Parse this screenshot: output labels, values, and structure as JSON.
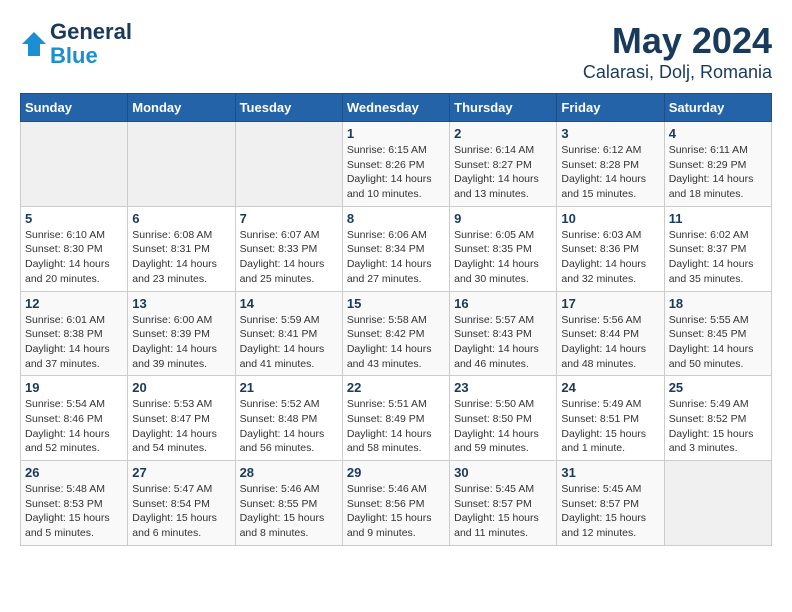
{
  "header": {
    "logo_line1": "General",
    "logo_line2": "Blue",
    "title": "May 2024",
    "subtitle": "Calarasi, Dolj, Romania"
  },
  "days_of_week": [
    "Sunday",
    "Monday",
    "Tuesday",
    "Wednesday",
    "Thursday",
    "Friday",
    "Saturday"
  ],
  "weeks": [
    [
      {
        "day": "",
        "info": ""
      },
      {
        "day": "",
        "info": ""
      },
      {
        "day": "",
        "info": ""
      },
      {
        "day": "1",
        "info": "Sunrise: 6:15 AM\nSunset: 8:26 PM\nDaylight: 14 hours\nand 10 minutes."
      },
      {
        "day": "2",
        "info": "Sunrise: 6:14 AM\nSunset: 8:27 PM\nDaylight: 14 hours\nand 13 minutes."
      },
      {
        "day": "3",
        "info": "Sunrise: 6:12 AM\nSunset: 8:28 PM\nDaylight: 14 hours\nand 15 minutes."
      },
      {
        "day": "4",
        "info": "Sunrise: 6:11 AM\nSunset: 8:29 PM\nDaylight: 14 hours\nand 18 minutes."
      }
    ],
    [
      {
        "day": "5",
        "info": "Sunrise: 6:10 AM\nSunset: 8:30 PM\nDaylight: 14 hours\nand 20 minutes."
      },
      {
        "day": "6",
        "info": "Sunrise: 6:08 AM\nSunset: 8:31 PM\nDaylight: 14 hours\nand 23 minutes."
      },
      {
        "day": "7",
        "info": "Sunrise: 6:07 AM\nSunset: 8:33 PM\nDaylight: 14 hours\nand 25 minutes."
      },
      {
        "day": "8",
        "info": "Sunrise: 6:06 AM\nSunset: 8:34 PM\nDaylight: 14 hours\nand 27 minutes."
      },
      {
        "day": "9",
        "info": "Sunrise: 6:05 AM\nSunset: 8:35 PM\nDaylight: 14 hours\nand 30 minutes."
      },
      {
        "day": "10",
        "info": "Sunrise: 6:03 AM\nSunset: 8:36 PM\nDaylight: 14 hours\nand 32 minutes."
      },
      {
        "day": "11",
        "info": "Sunrise: 6:02 AM\nSunset: 8:37 PM\nDaylight: 14 hours\nand 35 minutes."
      }
    ],
    [
      {
        "day": "12",
        "info": "Sunrise: 6:01 AM\nSunset: 8:38 PM\nDaylight: 14 hours\nand 37 minutes."
      },
      {
        "day": "13",
        "info": "Sunrise: 6:00 AM\nSunset: 8:39 PM\nDaylight: 14 hours\nand 39 minutes."
      },
      {
        "day": "14",
        "info": "Sunrise: 5:59 AM\nSunset: 8:41 PM\nDaylight: 14 hours\nand 41 minutes."
      },
      {
        "day": "15",
        "info": "Sunrise: 5:58 AM\nSunset: 8:42 PM\nDaylight: 14 hours\nand 43 minutes."
      },
      {
        "day": "16",
        "info": "Sunrise: 5:57 AM\nSunset: 8:43 PM\nDaylight: 14 hours\nand 46 minutes."
      },
      {
        "day": "17",
        "info": "Sunrise: 5:56 AM\nSunset: 8:44 PM\nDaylight: 14 hours\nand 48 minutes."
      },
      {
        "day": "18",
        "info": "Sunrise: 5:55 AM\nSunset: 8:45 PM\nDaylight: 14 hours\nand 50 minutes."
      }
    ],
    [
      {
        "day": "19",
        "info": "Sunrise: 5:54 AM\nSunset: 8:46 PM\nDaylight: 14 hours\nand 52 minutes."
      },
      {
        "day": "20",
        "info": "Sunrise: 5:53 AM\nSunset: 8:47 PM\nDaylight: 14 hours\nand 54 minutes."
      },
      {
        "day": "21",
        "info": "Sunrise: 5:52 AM\nSunset: 8:48 PM\nDaylight: 14 hours\nand 56 minutes."
      },
      {
        "day": "22",
        "info": "Sunrise: 5:51 AM\nSunset: 8:49 PM\nDaylight: 14 hours\nand 58 minutes."
      },
      {
        "day": "23",
        "info": "Sunrise: 5:50 AM\nSunset: 8:50 PM\nDaylight: 14 hours\nand 59 minutes."
      },
      {
        "day": "24",
        "info": "Sunrise: 5:49 AM\nSunset: 8:51 PM\nDaylight: 15 hours\nand 1 minute."
      },
      {
        "day": "25",
        "info": "Sunrise: 5:49 AM\nSunset: 8:52 PM\nDaylight: 15 hours\nand 3 minutes."
      }
    ],
    [
      {
        "day": "26",
        "info": "Sunrise: 5:48 AM\nSunset: 8:53 PM\nDaylight: 15 hours\nand 5 minutes."
      },
      {
        "day": "27",
        "info": "Sunrise: 5:47 AM\nSunset: 8:54 PM\nDaylight: 15 hours\nand 6 minutes."
      },
      {
        "day": "28",
        "info": "Sunrise: 5:46 AM\nSunset: 8:55 PM\nDaylight: 15 hours\nand 8 minutes."
      },
      {
        "day": "29",
        "info": "Sunrise: 5:46 AM\nSunset: 8:56 PM\nDaylight: 15 hours\nand 9 minutes."
      },
      {
        "day": "30",
        "info": "Sunrise: 5:45 AM\nSunset: 8:57 PM\nDaylight: 15 hours\nand 11 minutes."
      },
      {
        "day": "31",
        "info": "Sunrise: 5:45 AM\nSunset: 8:57 PM\nDaylight: 15 hours\nand 12 minutes."
      },
      {
        "day": "",
        "info": ""
      }
    ]
  ]
}
